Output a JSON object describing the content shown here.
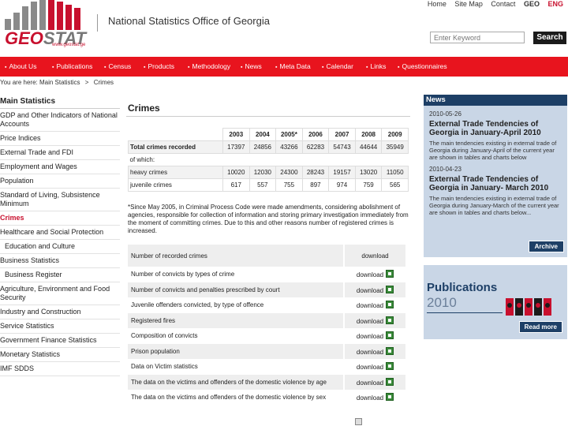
{
  "header": {
    "logo_text_1": "GEO",
    "logo_text_2": "STAT",
    "logo_url": "www.geostat.ge",
    "org_name": "National Statistics Office of Georgia",
    "top_links": [
      "Home",
      "Site Map",
      "Contact"
    ],
    "lang_geo": "GEO",
    "lang_eng": "ENG",
    "search_placeholder": "Enter Keyword",
    "search_button": "Search"
  },
  "nav": [
    "About Us",
    "Publications",
    "Census",
    "Products",
    "Methodology",
    "News",
    "Meta Data",
    "Calendar",
    "Links",
    "Questionnaires"
  ],
  "breadcrumb": {
    "prefix": "You are here:",
    "items": [
      "Main Statistics",
      "Crimes"
    ],
    "separator": ">"
  },
  "sidebar": {
    "title": "Main Statistics",
    "items": [
      {
        "label": "GDP and Other Indicators of National Accounts"
      },
      {
        "label": "Price Indices"
      },
      {
        "label": "External Trade and FDI"
      },
      {
        "label": "Employment and Wages"
      },
      {
        "label": "Population"
      },
      {
        "label": "Standard of Living, Subsistence Minimum"
      },
      {
        "label": "Crimes"
      },
      {
        "label": "Healthcare and Social Protection"
      },
      {
        "label": "Education and Culture"
      },
      {
        "label": "Business Statistics"
      },
      {
        "label": "Business Register"
      },
      {
        "label": "Agriculture, Environment and Food Security"
      },
      {
        "label": "Industry and Construction"
      },
      {
        "label": "Service Statistics"
      },
      {
        "label": "Government Finance Statistics"
      },
      {
        "label": "Monetary Statistics"
      },
      {
        "label": "IMF SDDS"
      }
    ],
    "active_index": 6
  },
  "main": {
    "title": "Crimes",
    "table": {
      "years": [
        "2003",
        "2004",
        "2005*",
        "2006",
        "2007",
        "2008",
        "2009"
      ],
      "rows": [
        {
          "label": "Total crimes recorded",
          "values": [
            "17397",
            "24856",
            "43266",
            "62283",
            "54743",
            "44644",
            "35949"
          ]
        },
        {
          "label": "of which:",
          "values": [
            "",
            "",
            "",
            "",
            "",
            "",
            ""
          ]
        },
        {
          "label": "heavy crimes",
          "values": [
            "10020",
            "12030",
            "24300",
            "28243",
            "19157",
            "13020",
            "11050"
          ]
        },
        {
          "label": "juvenile crimes",
          "values": [
            "617",
            "557",
            "755",
            "897",
            "974",
            "759",
            "565"
          ]
        }
      ]
    },
    "footnote": "*Since May 2005, in Criminal Process Code were made amendments, considering abolishment of agencies, responsible for collection of information and storing primary investigation immediately from the moment of committing crimes. Due to this and other reasons number of registered crimes is increased.",
    "downloads": {
      "header_label": "Number of recorded crimes",
      "header_action": "download",
      "action_label": "download",
      "items": [
        "Number of convicts by types of crime",
        "Number of convicts and penalties prescribed by court",
        "Juvenile offenders convicted, by type of offence",
        "Registered fires",
        "Composition of convicts",
        "Prison population",
        "Data on Victim statistics",
        "The data on the victims and offenders of the domestic violence by age",
        "The data on the victims and offenders of the domestic violence by sex"
      ]
    }
  },
  "news": {
    "heading": "News",
    "items": [
      {
        "date": "2010-05-26",
        "title": "External Trade Tendencies of Georgia in January-April 2010",
        "body": "The main tendencies existing in external trade of Georgia during January-April of the current year are shown in tables and charts below"
      },
      {
        "date": "2010-04-23",
        "title": "External Trade Tendencies of Georgia in January- March 2010",
        "body": "The main tendencies existing in external trade of Georgia during January-March of the current year are shown in tables and charts below..."
      }
    ],
    "archive_label": "Archive"
  },
  "publications": {
    "title": "Publications",
    "year": "2010",
    "read_more": "Read more"
  },
  "colors": {
    "brand_red": "#e8141e",
    "navy": "#1d3f66",
    "panel_blue": "#c9d6e6"
  }
}
